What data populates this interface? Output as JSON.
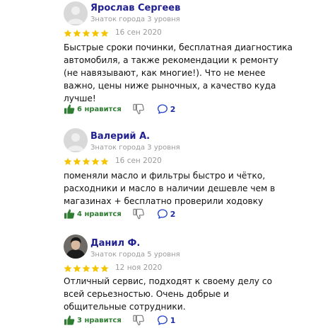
{
  "colors": {
    "star": "#f5c400",
    "like": "#2e7d32",
    "name": "#1f1f8f",
    "muted": "#9a9a9a",
    "comment": "#2445c9"
  },
  "reviews": [
    {
      "author": "Ярослав Сергеев",
      "level": "Знаток города 3 уровня",
      "rating": 5,
      "date": "16 сен 2020",
      "text": [
        "Быстрые сроки починки, бесплатная диагностика",
        "автомобиля, а также рекомендации к ремонту",
        "(не навязывают, как многие!). Что не менее",
        "важно, цены ниже рыночных, а качество куда",
        "лучше!"
      ],
      "likes": "6 нравится",
      "comments": "2",
      "avatar": "placeholder"
    },
    {
      "author": "Валерий А.",
      "level": "Знаток города 3 уровня",
      "rating": 5,
      "date": "16 сен 2020",
      "text": [
        "поменяли масло и фильтры быстро и чётко,",
        "расходники и масло в наличии дешевле чем в",
        "магазинах + бесплатно проверили ходовку"
      ],
      "likes": "4 нравится",
      "comments": "2",
      "avatar": "placeholder"
    },
    {
      "author": "Данил Ф.",
      "level": "Знаток города 5 уровня",
      "rating": 5,
      "date": "12 ноя 2020",
      "text": [
        "Отличный сервис, подходят к своему делу со",
        "всей серьезностью. Очень добрые и",
        "общительные сотрудники."
      ],
      "likes": "3 нравится",
      "comments": "1",
      "avatar": "photo"
    }
  ]
}
